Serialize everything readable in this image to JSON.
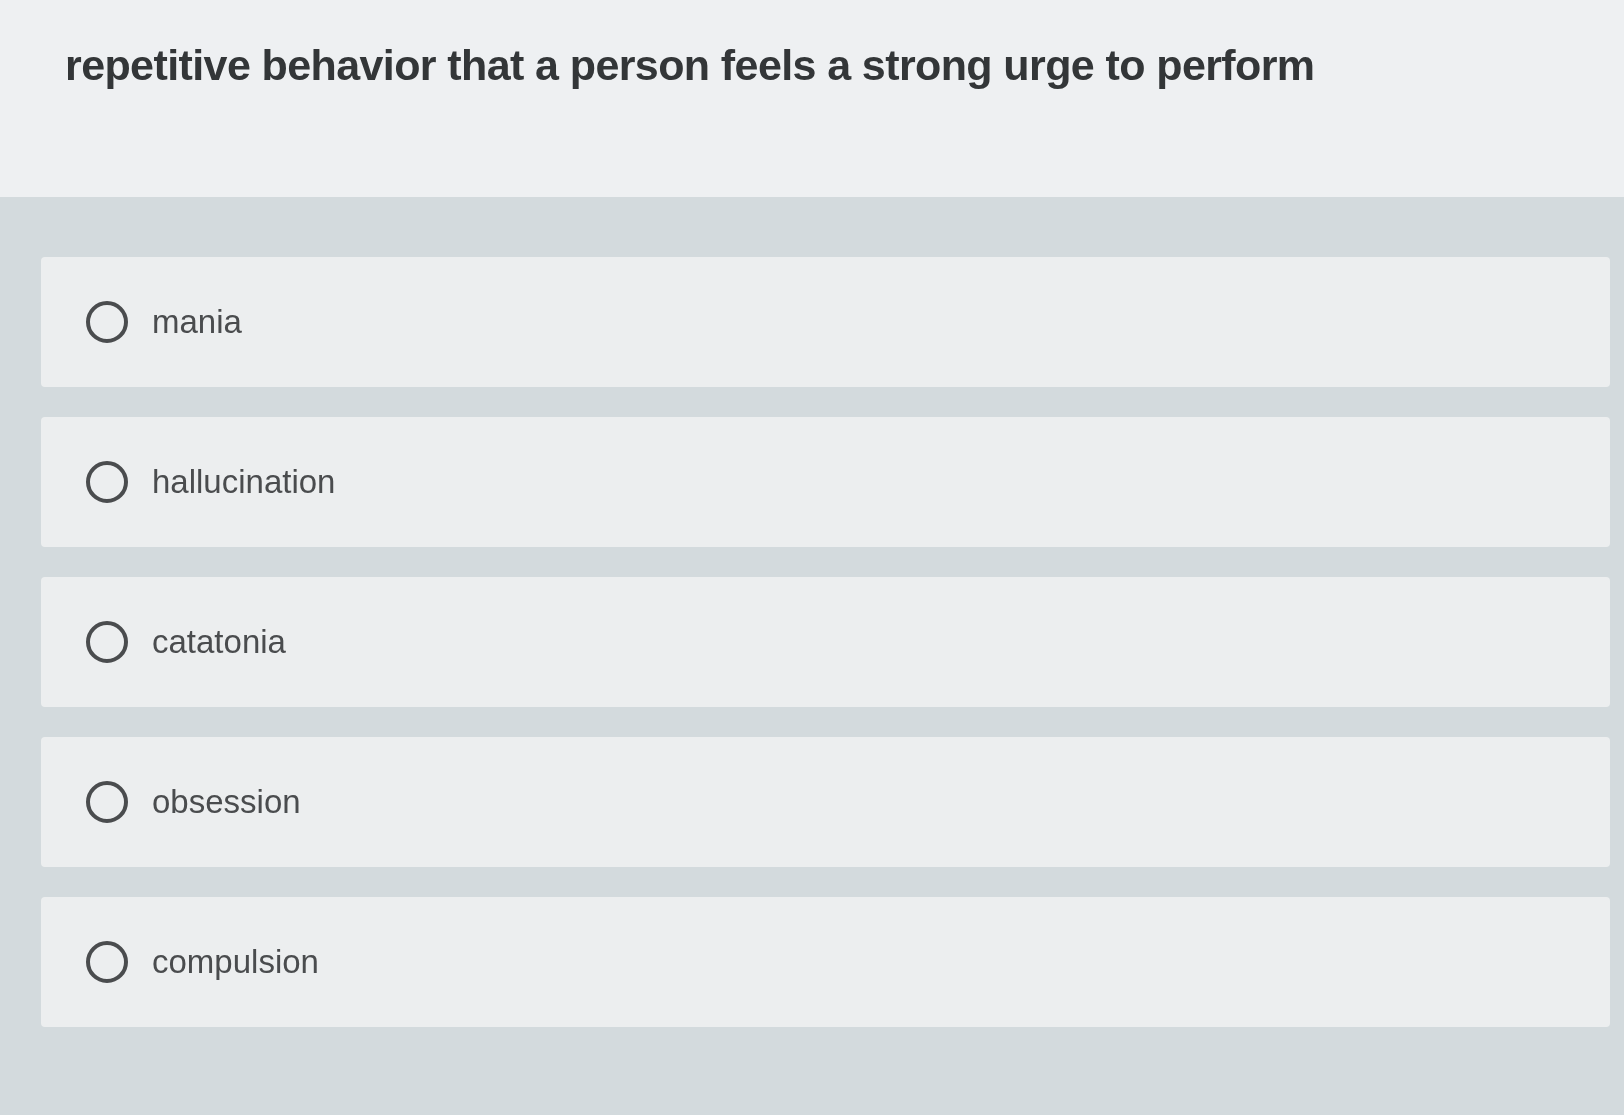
{
  "question": "repetitive behavior that a person feels a strong urge to perform",
  "options": [
    {
      "label": "mania",
      "selected": false
    },
    {
      "label": "hallucination",
      "selected": false
    },
    {
      "label": "catatonia",
      "selected": false
    },
    {
      "label": "obsession",
      "selected": false
    },
    {
      "label": "compulsion",
      "selected": false
    }
  ]
}
